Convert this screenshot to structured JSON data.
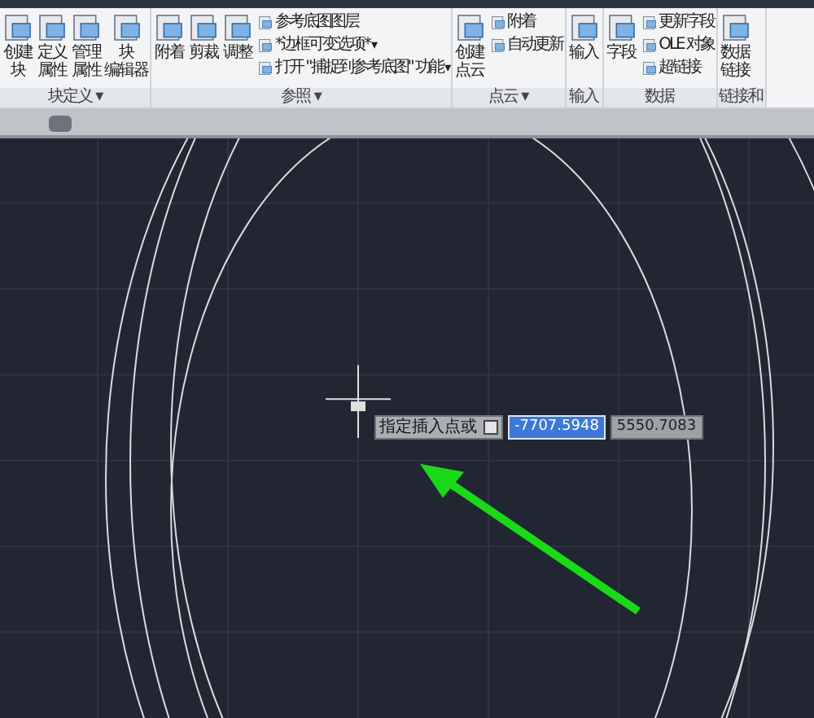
{
  "ribbon": {
    "panels": [
      {
        "title": "块定义",
        "menu_arrow": "▾",
        "large_buttons": [
          {
            "lines": [
              "创建",
              "块"
            ]
          },
          {
            "lines": [
              "定义",
              "属性"
            ]
          },
          {
            "lines": [
              "管理",
              "属性"
            ]
          },
          {
            "lines": [
              "块",
              "编辑器"
            ]
          }
        ]
      },
      {
        "title": "参照",
        "menu_arrow": "▾",
        "large_buttons": [
          {
            "lines": [
              "附着"
            ]
          },
          {
            "lines": [
              "剪裁"
            ]
          },
          {
            "lines": [
              "调整"
            ]
          }
        ],
        "small_buttons": [
          {
            "label": "参考底图图层"
          },
          {
            "label": "*边框可变选项*",
            "arrow": "▾"
          },
          {
            "label": "打开 \"捕捉到参考底图\" 功能",
            "arrow": "▾"
          }
        ]
      },
      {
        "title": "点云",
        "menu_arrow": "▾",
        "large_buttons": [
          {
            "lines": [
              "创建",
              "点云"
            ]
          }
        ],
        "small_buttons": [
          {
            "label": "附着"
          },
          {
            "label": "自动更新"
          }
        ]
      },
      {
        "title": "输入",
        "large_buttons": [
          {
            "lines": [
              "输入"
            ]
          }
        ]
      },
      {
        "title": "数据",
        "large_buttons": [
          {
            "lines": [
              "字段"
            ]
          }
        ],
        "small_buttons": [
          {
            "label": "更新字段"
          },
          {
            "label": "OLE 对象"
          },
          {
            "label": "超链接"
          }
        ]
      },
      {
        "title": "链接和",
        "large_buttons": [
          {
            "lines": [
              "数据",
              "链接"
            ]
          }
        ]
      }
    ]
  },
  "canvas": {
    "prompt": {
      "label": "指定插入点或",
      "x_value": "-7707.5948",
      "y_value": "5550.7083"
    }
  }
}
